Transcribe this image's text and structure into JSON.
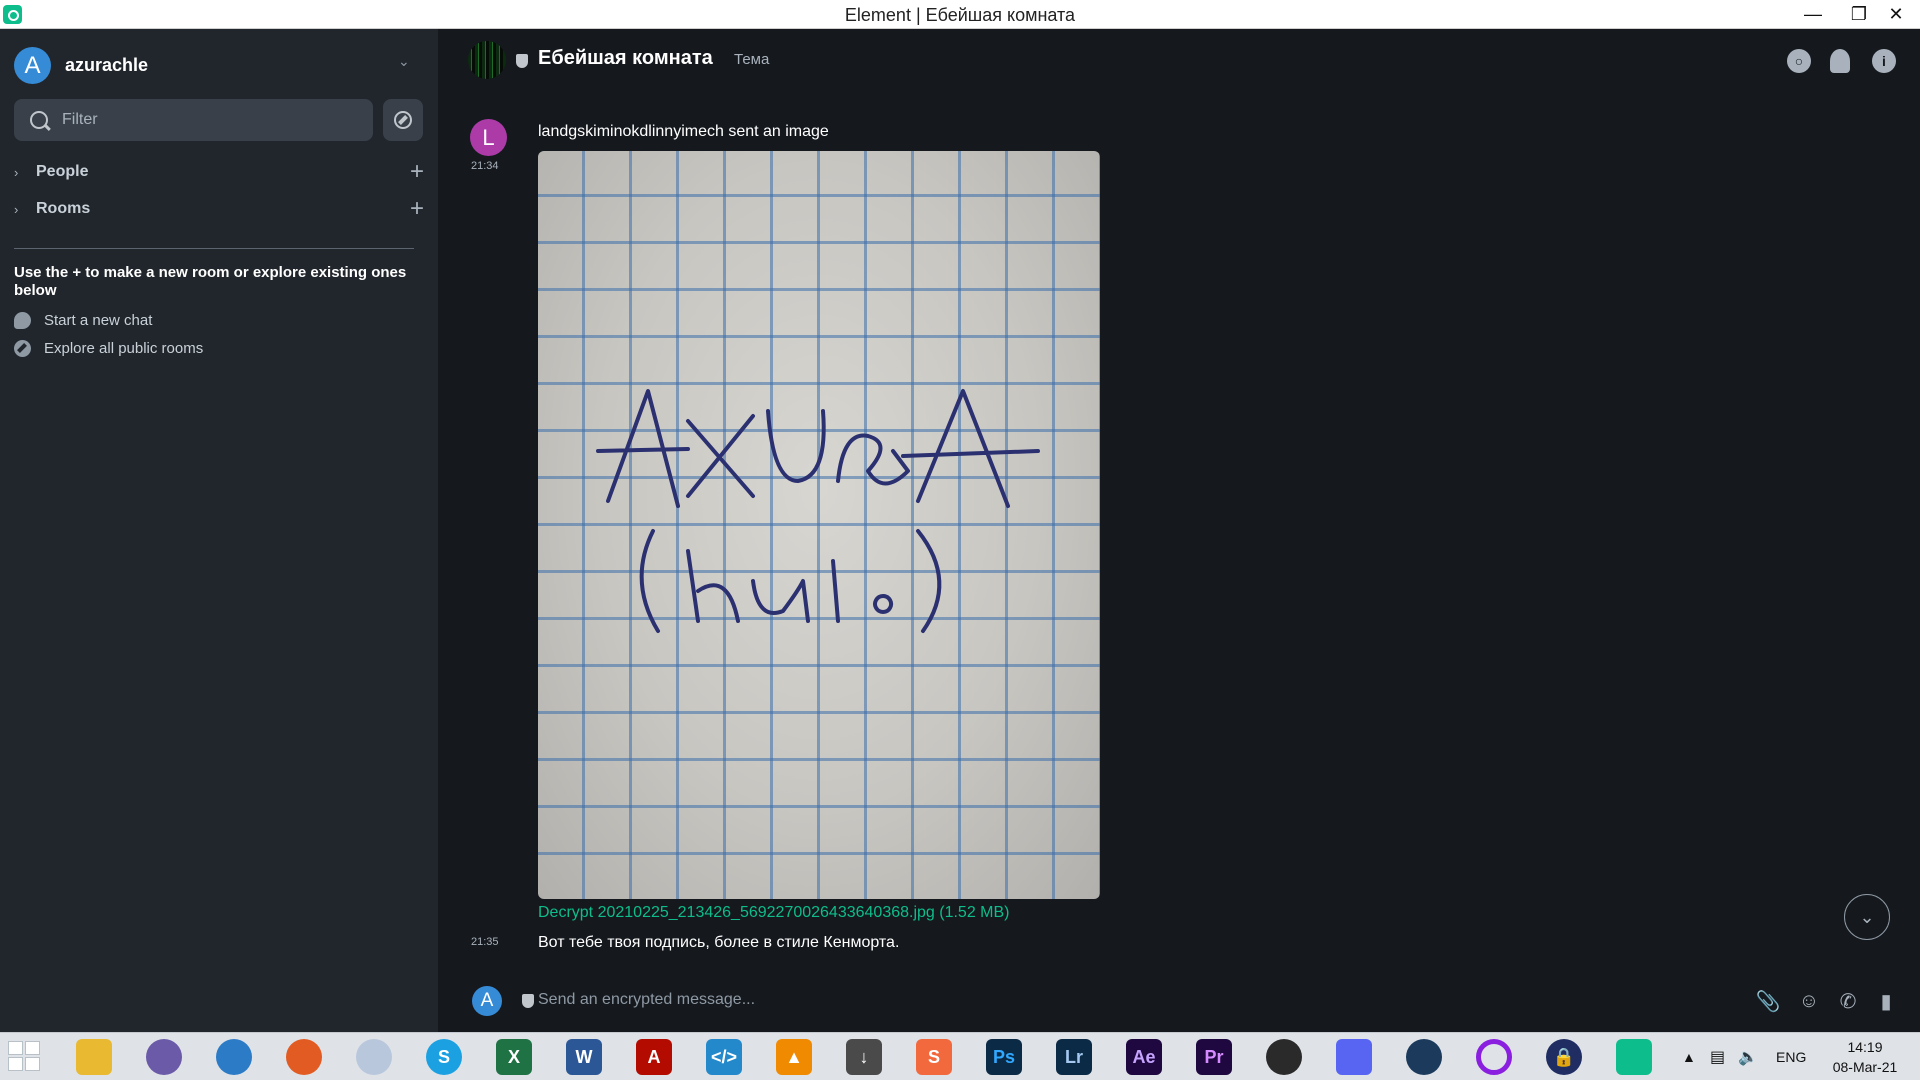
{
  "window": {
    "title": "Element | Ебейшая комната",
    "minimize": "—",
    "maximize": "❐",
    "close": "✕"
  },
  "account": {
    "initial": "A",
    "name": "azurachle"
  },
  "filter": {
    "placeholder": "Filter"
  },
  "sections": [
    {
      "label": "People"
    },
    {
      "label": "Rooms"
    }
  ],
  "hint": {
    "text": "Use the + to make a new room or explore existing ones below",
    "start_chat": "Start a new chat",
    "explore": "Explore all public rooms"
  },
  "room": {
    "name": "Ебейшая комната",
    "topic": "Тема"
  },
  "messages": [
    {
      "avatar_initial": "L",
      "avatar_color": "#ac3ba8",
      "time": "21:34",
      "text": "landgskiminokdlinnyimech sent an image",
      "file": "Decrypt 20210225_213426_5692270026433640368.jpg (1.52 MB)"
    },
    {
      "time": "21:35",
      "text": "Вот тебе твоя подпись, более в стиле Кенморта."
    }
  ],
  "composer": {
    "initial": "A",
    "placeholder": "Send an encrypted message..."
  },
  "taskbar": {
    "apps": [
      "file-explorer",
      "qbittorrent",
      "browser-globe",
      "firefox",
      "moon-app",
      "skype",
      "excel",
      "word",
      "acrobat",
      "vscode",
      "vlc",
      "downloader",
      "sublime",
      "photoshop",
      "lightroom",
      "after-effects",
      "premiere",
      "obs",
      "discord",
      "steam",
      "cortana-ring",
      "vpn-lock",
      "element"
    ],
    "lang": "ENG",
    "time": "14:19",
    "date": "08-Mar-21"
  },
  "colors": {
    "accent": "#0dbd8b",
    "sidebar": "#21262c",
    "timeline": "#15191e",
    "user_blue": "#368bd6"
  }
}
